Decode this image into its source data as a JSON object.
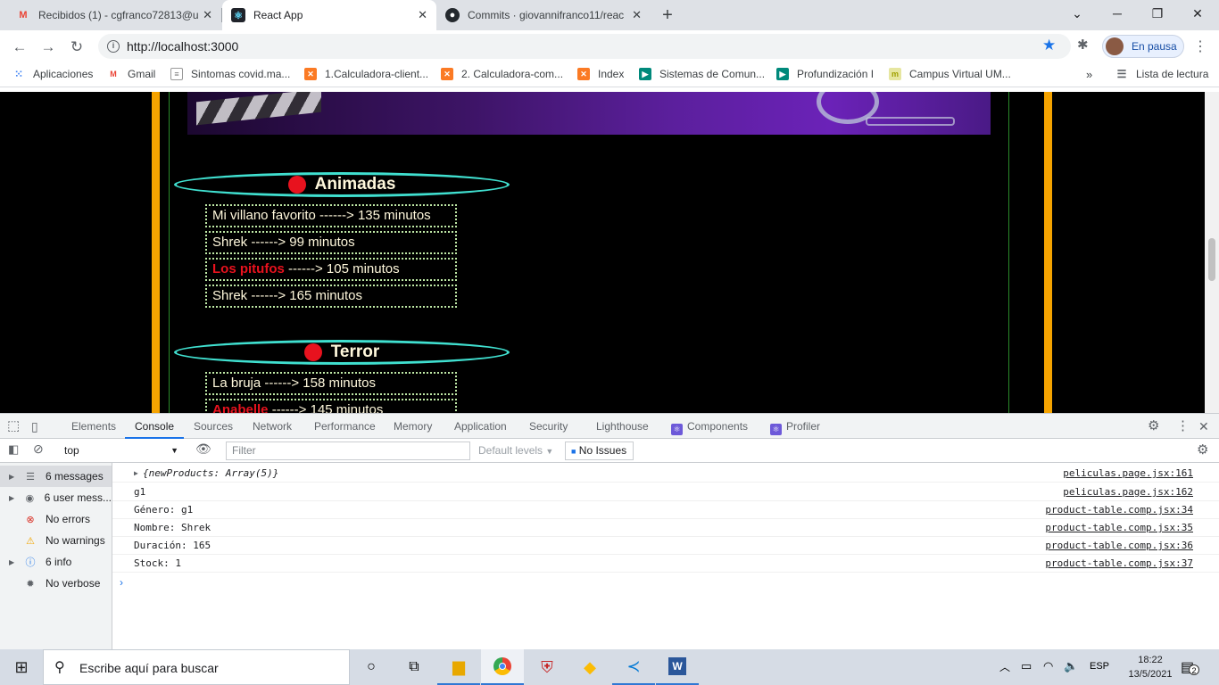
{
  "tabs": [
    {
      "title": "Recibidos (1) - cgfranco72813@u",
      "icon": "gmail-icon",
      "active": false
    },
    {
      "title": "React App",
      "icon": "react-icon",
      "active": true
    },
    {
      "title": "Commits · giovannifranco11/reac",
      "icon": "github-icon",
      "active": false
    }
  ],
  "toolbar": {
    "url": "http://localhost:3000",
    "profile_label": "En pausa"
  },
  "bookmarks": [
    {
      "label": "Aplicaciones",
      "icon": "apps-grid-icon"
    },
    {
      "label": "Gmail",
      "icon": "gmail-icon"
    },
    {
      "label": "Sintomas covid.ma...",
      "icon": "doc-icon"
    },
    {
      "label": "1.Calculadora-client...",
      "icon": "xampp-icon"
    },
    {
      "label": "2. Calculadora-com...",
      "icon": "xampp-icon"
    },
    {
      "label": "Index",
      "icon": "xampp-icon"
    },
    {
      "label": "Sistemas de Comun...",
      "icon": "meet-icon"
    },
    {
      "label": "Profundización I",
      "icon": "meet-icon"
    },
    {
      "label": "Campus Virtual UM...",
      "icon": "moodle-icon"
    }
  ],
  "reading_list": "Lista de lectura",
  "page": {
    "genres": [
      {
        "name": "Animadas",
        "movies": [
          {
            "name": "Mi villano favorito",
            "rest": " ------> 135 minutos",
            "low_stock": false
          },
          {
            "name": "Shrek",
            "rest": " ------> 99 minutos",
            "low_stock": false
          },
          {
            "name": "Los pitufos",
            "rest": " ------> 105 minutos",
            "low_stock": true
          },
          {
            "name": "Shrek",
            "rest": " ------> 165 minutos",
            "low_stock": false
          }
        ]
      },
      {
        "name": "Terror",
        "movies": [
          {
            "name": "La bruja",
            "rest": " ------> 158 minutos",
            "low_stock": false
          },
          {
            "name": "Anabelle",
            "rest": " ------> 145 minutos",
            "low_stock": true
          }
        ]
      }
    ],
    "low_stock_color": "#e8121e"
  },
  "devtools": {
    "tabs": [
      "Elements",
      "Console",
      "Sources",
      "Network",
      "Performance",
      "Memory",
      "Application",
      "Security",
      "Lighthouse",
      "Components",
      "Profiler"
    ],
    "active_tab": "Console",
    "context": "top",
    "filter_placeholder": "Filter",
    "levels": "Default levels",
    "issues": "No Issues",
    "sidebar": [
      {
        "label": "6 messages",
        "icon": "list-icon",
        "expandable": true
      },
      {
        "label": "6 user mess...",
        "icon": "user-icon",
        "expandable": true
      },
      {
        "label": "No errors",
        "icon": "error-icon",
        "expandable": false
      },
      {
        "label": "No warnings",
        "icon": "warning-icon",
        "expandable": false
      },
      {
        "label": "6 info",
        "icon": "info-icon",
        "expandable": true
      },
      {
        "label": "No verbose",
        "icon": "bug-icon",
        "expandable": false
      }
    ],
    "logs": [
      {
        "text": "{newProducts: Array(5)}",
        "source": "peliculas.page.jsx:161",
        "object": true
      },
      {
        "text": "g1",
        "source": "peliculas.page.jsx:162",
        "object": false
      },
      {
        "text": "Género: g1",
        "source": "product-table.comp.jsx:34",
        "object": false
      },
      {
        "text": "Nombre: Shrek",
        "source": "product-table.comp.jsx:35",
        "object": false
      },
      {
        "text": "Duración: 165",
        "source": "product-table.comp.jsx:36",
        "object": false
      },
      {
        "text": "Stock: 1",
        "source": "product-table.comp.jsx:37",
        "object": false
      }
    ]
  },
  "taskbar": {
    "search_placeholder": "Escribe aquí para buscar",
    "language": "ESP",
    "time": "18:22",
    "date": "13/5/2021",
    "notifications": "2"
  }
}
